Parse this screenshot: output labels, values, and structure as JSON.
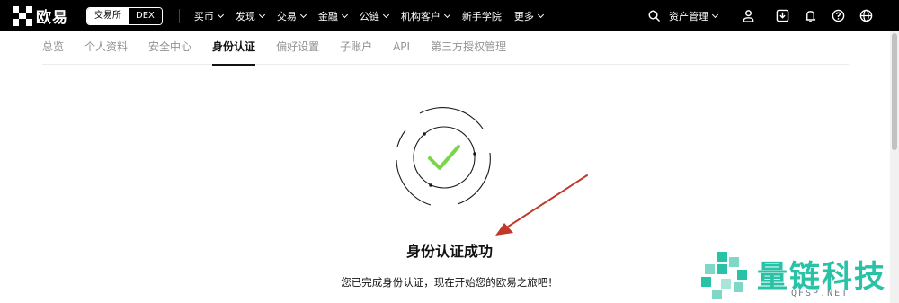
{
  "brand": {
    "name": "欧易"
  },
  "segment": {
    "exchange": "交易所",
    "dex": "DEX"
  },
  "nav": {
    "items": [
      {
        "label": "买币",
        "dropdown": true
      },
      {
        "label": "发现",
        "dropdown": true
      },
      {
        "label": "交易",
        "dropdown": true
      },
      {
        "label": "金融",
        "dropdown": true
      },
      {
        "label": "公链",
        "dropdown": true
      },
      {
        "label": "机构客户",
        "dropdown": true
      },
      {
        "label": "新手学院",
        "dropdown": false
      },
      {
        "label": "更多",
        "dropdown": true
      }
    ],
    "asset_label": "资产管理",
    "icons": [
      "search-icon",
      "user-icon",
      "download-icon",
      "bell-icon",
      "help-icon",
      "globe-icon"
    ]
  },
  "tabs": [
    {
      "label": "总览"
    },
    {
      "label": "个人资料"
    },
    {
      "label": "安全中心"
    },
    {
      "label": "身份认证",
      "active": true
    },
    {
      "label": "偏好设置"
    },
    {
      "label": "子账户"
    },
    {
      "label": "API"
    },
    {
      "label": "第三方授权管理"
    }
  ],
  "success": {
    "title": "身份认证成功",
    "description": "您已完成身份认证，现在开始您的欧易之旅吧！",
    "check_color": "#7ad54a",
    "arrow_color": "#c0392b"
  },
  "watermark": {
    "text": "量链科技",
    "sub": "QFSP.NET",
    "color": "#28c2a6"
  }
}
